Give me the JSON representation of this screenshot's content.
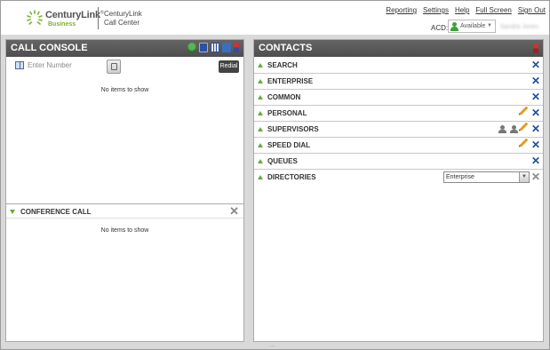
{
  "header": {
    "brand_name": "CenturyLink",
    "brand_tm": "®",
    "brand_sub": "Business",
    "app_name": "CenturyLink Call Center",
    "links": [
      "Reporting",
      "Settings",
      "Help",
      "Full Screen",
      "Sign Out"
    ],
    "acd_label": "ACD:",
    "acd_status": "Available",
    "user_name": "Sandra Jones",
    "colors": {
      "brand_green": "#78b42b",
      "text_dark": "#555555"
    }
  },
  "call_console": {
    "title": "CALL CONSOLE",
    "header_icons": [
      "headset-icon",
      "contact-card-icon",
      "dialpad-icon",
      "message-icon",
      "phone-icon"
    ],
    "enter_number_placeholder": "Enter Number",
    "redial_label": "Redial",
    "empty_text": "No items to show"
  },
  "conference_call": {
    "title": "CONFERENCE CALL",
    "empty_text": "No items to show"
  },
  "contacts": {
    "title": "CONTACTS",
    "header_icon": "phone-off-icon",
    "rows": [
      {
        "label": "SEARCH"
      },
      {
        "label": "ENTERPRISE"
      },
      {
        "label": "COMMON"
      },
      {
        "label": "PERSONAL"
      },
      {
        "label": "SUPERVISORS"
      },
      {
        "label": "SPEED DIAL"
      },
      {
        "label": "QUEUES"
      },
      {
        "label": "DIRECTORIES"
      }
    ],
    "directory_selected": "Enterprise"
  },
  "footer": {
    "grip": "....."
  }
}
